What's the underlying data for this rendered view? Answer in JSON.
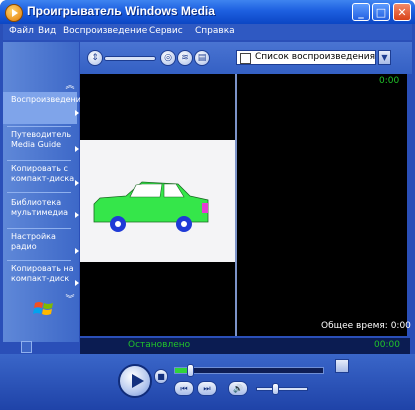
{
  "window": {
    "title": "Проигрыватель Windows Media",
    "caption": {
      "minimize": "_",
      "maximize": "□",
      "close": "✕"
    }
  },
  "menu": [
    "Файл",
    "Вид",
    "Воспроизведение",
    "Сервис",
    "Справка"
  ],
  "taskbar": {
    "items": [
      {
        "label": "Воспроизведение",
        "active": true
      },
      {
        "label": "Путеводитель Media Guide"
      },
      {
        "label": "Копировать с компакт-диска"
      },
      {
        "label": "Библиотека мультимедиа"
      },
      {
        "label": "Настройка радио"
      },
      {
        "label": "Копировать на компакт-диск"
      }
    ]
  },
  "toolbar": {
    "playlist_selected": "Список воспроизведения"
  },
  "playlist_panel": {
    "time": "0:00",
    "total_label": "Общее время: 0:00"
  },
  "status": {
    "text": "Остановлено",
    "time": "00:00"
  },
  "playback": {
    "progress": 0.1,
    "volume": 0.35
  },
  "colors": {
    "title_bar": "#1d5fe0",
    "frame": "#2a4fb8",
    "status_green": "#21c32a",
    "car_body": "#35e64a",
    "car_wheel": "#1f3ad6",
    "car_accent": "#e83bd6"
  }
}
